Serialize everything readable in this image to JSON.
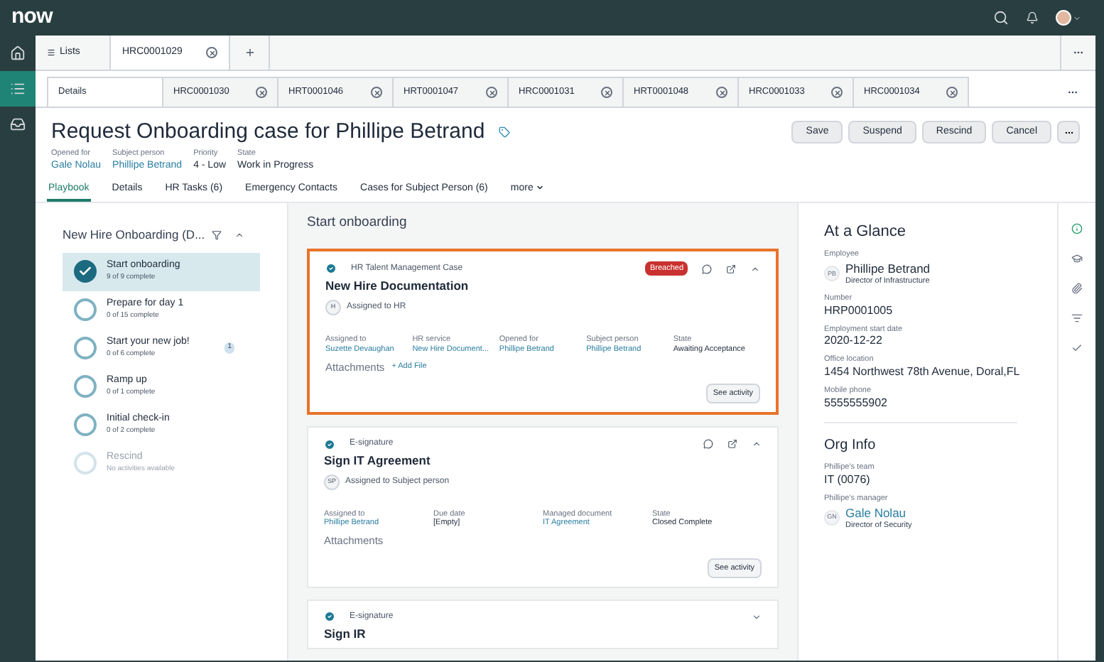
{
  "top_bar": {
    "logo": "now"
  },
  "rail": [
    {
      "kind": "home",
      "selected": false
    },
    {
      "kind": "list",
      "selected": true
    },
    {
      "kind": "inbox",
      "selected": false
    }
  ],
  "workspace_tabs": {
    "lists": "Lists",
    "tabs": [
      {
        "label": "HRC0001029",
        "selected": true
      }
    ]
  },
  "record_tabs": [
    {
      "label": "Details",
      "selected": true
    },
    {
      "label": "HRC0001030",
      "selected": false
    },
    {
      "label": "HRT0001046",
      "selected": false
    },
    {
      "label": "HRT0001047",
      "selected": false
    },
    {
      "label": "HRC0001031",
      "selected": false
    },
    {
      "label": "HRT0001048",
      "selected": false
    },
    {
      "label": "HRC0001033",
      "selected": false
    },
    {
      "label": "HRC0001034",
      "selected": false
    }
  ],
  "header": {
    "title": "Request Onboarding case for Phillipe Betrand",
    "fields": [
      {
        "label": "Opened for",
        "value": "Gale Nolau",
        "link": true
      },
      {
        "label": "Subject person",
        "value": "Phillipe Betrand",
        "link": true
      },
      {
        "label": "Priority",
        "value": "4 - Low",
        "link": false
      },
      {
        "label": "State",
        "value": "Work in Progress",
        "link": false
      }
    ],
    "buttons": [
      "Save",
      "Suspend",
      "Rescind",
      "Cancel"
    ]
  },
  "sub_tabs": [
    {
      "label": "Playbook",
      "selected": true,
      "kind": "tab"
    },
    {
      "label": "Details",
      "selected": false,
      "kind": "tab"
    },
    {
      "label": "HR Tasks (6)",
      "selected": false,
      "kind": "tab"
    },
    {
      "label": "Emergency Contacts",
      "selected": false,
      "kind": "tab"
    },
    {
      "label": "Cases for Subject Person (6)",
      "selected": false,
      "kind": "tab"
    },
    {
      "label": "more",
      "selected": false,
      "kind": "menu"
    }
  ],
  "playbook": {
    "title": "New Hire Onboarding (D...",
    "stages": [
      {
        "name": "Start onboarding",
        "progress": "9 of 9 complete",
        "kind": "complete",
        "selected": true
      },
      {
        "name": "Prepare for day 1",
        "progress": "0 of 15 complete",
        "kind": "pending",
        "selected": false
      },
      {
        "name": "Start your new job!",
        "progress": "0 of 6 complete",
        "kind": "pending",
        "selected": false,
        "badge": "1"
      },
      {
        "name": "Ramp up",
        "progress": "0 of 1 complete",
        "kind": "pending",
        "selected": false
      },
      {
        "name": "Initial check-in",
        "progress": "0 of 2 complete",
        "kind": "pending",
        "selected": false
      },
      {
        "name": "Rescind",
        "progress": "No activities available",
        "kind": "disabled",
        "selected": false
      }
    ]
  },
  "activity": {
    "heading": "Start onboarding",
    "cards": [
      {
        "type": "HR Talent Management Case",
        "title": "New Hire Documentation",
        "initials": "H",
        "assigned": "Assigned to HR",
        "badge": "Breached",
        "highlighted": true,
        "expanded": true,
        "actions": true,
        "fields": [
          {
            "label": "Assigned to",
            "value": "Suzette Devaughan",
            "link": true
          },
          {
            "label": "HR service",
            "value": "New Hire Document...",
            "link": true
          },
          {
            "label": "Opened for",
            "value": "Phillipe Betrand",
            "link": true
          },
          {
            "label": "Subject person",
            "value": "Phillipe Betrand",
            "link": true
          },
          {
            "label": "State",
            "value": "Awaiting Acceptance",
            "link": false
          }
        ],
        "attachments": "Attachments",
        "add_file": "+ Add File",
        "button": "See activity"
      },
      {
        "type": "E-signature",
        "title": "Sign IT Agreement",
        "initials": "SP",
        "assigned": "Assigned to Subject person",
        "highlighted": false,
        "expanded": true,
        "actions": true,
        "fields": [
          {
            "label": "Assigned to",
            "value": "Phillipe Betrand",
            "link": true
          },
          {
            "label": "Due date",
            "value": "[Empty]",
            "link": false
          },
          {
            "label": "Managed document",
            "value": "IT Agreement",
            "link": true
          },
          {
            "label": "State",
            "value": "Closed Complete",
            "link": false
          }
        ],
        "attachments": "Attachments",
        "button": "See activity"
      },
      {
        "type": "E-signature",
        "title": "Sign IR",
        "highlighted": false,
        "expanded": false,
        "actions": false
      }
    ]
  },
  "glance": {
    "title": "At a Glance",
    "fields": [
      {
        "kind": "person",
        "label": "Employee",
        "initials": "PB",
        "value": "Phillipe Betrand",
        "subtitle": "Director of Infrastructure",
        "link": false
      },
      {
        "kind": "text",
        "label": "Number",
        "value": "HRP0001005"
      },
      {
        "kind": "text",
        "label": "Employment start date",
        "value": "2020-12-22"
      },
      {
        "kind": "text",
        "label": "Office location",
        "value": "1454 Northwest 78th Avenue, Doral,FL"
      },
      {
        "kind": "text",
        "label": "Mobile phone",
        "value": "5555555902"
      }
    ]
  },
  "org_info": {
    "title": "Org Info",
    "fields": [
      {
        "kind": "text",
        "label": "Phillipe's team",
        "value": "IT (0076)"
      },
      {
        "kind": "person",
        "label": "Phillipe's manager",
        "initials": "GN",
        "value": "Gale Nolau",
        "subtitle": "Director of Security",
        "link": true
      }
    ]
  },
  "side_icons": [
    {
      "kind": "info",
      "selected": true
    },
    {
      "kind": "cap",
      "selected": false
    },
    {
      "kind": "clip",
      "selected": false
    },
    {
      "kind": "list",
      "selected": false
    },
    {
      "kind": "check",
      "selected": false
    }
  ]
}
